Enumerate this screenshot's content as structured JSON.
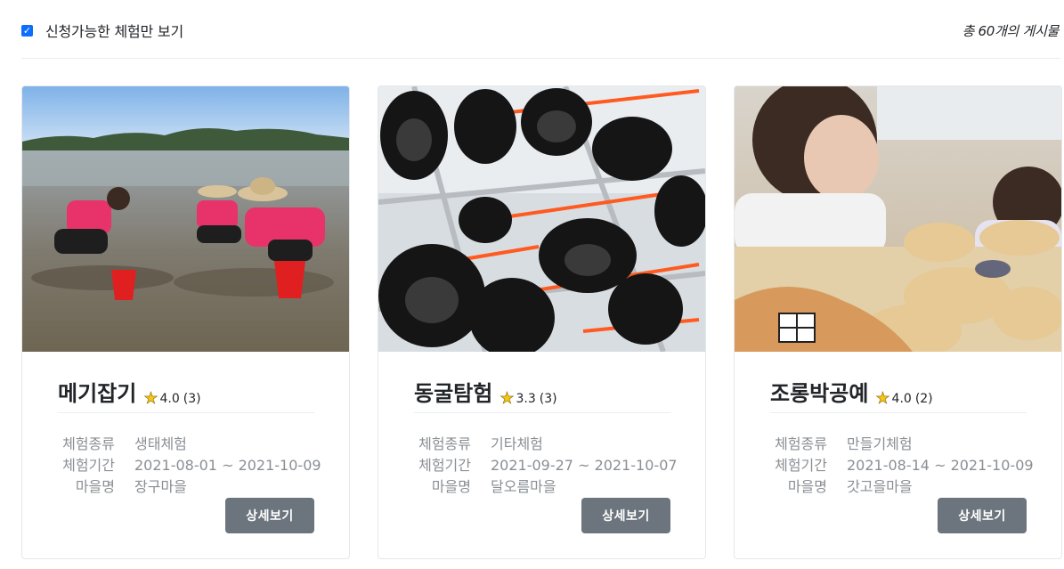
{
  "filter": {
    "checked": true,
    "label": "신청가능한 체험만 보기"
  },
  "total_count": "총 60개의 게시물",
  "cards": [
    {
      "title": "메기잡기",
      "rating": "4.0",
      "review_count": "(3)",
      "type_label": "체험종류",
      "type_value": "생태체험",
      "period_label": "체험기간",
      "period_value": "2021-08-01 ~ 2021-10-09",
      "village_label": "마을명",
      "village_value": "장구마을",
      "button_label": "상세보기"
    },
    {
      "title": "동굴탐험",
      "rating": "3.3",
      "review_count": "(3)",
      "type_label": "체험종류",
      "type_value": "기타체험",
      "period_label": "체험기간",
      "period_value": "2021-09-27 ~ 2021-10-07",
      "village_label": "마을명",
      "village_value": "달오름마을",
      "button_label": "상세보기"
    },
    {
      "title": "조롱박공예",
      "rating": "4.0",
      "review_count": "(2)",
      "type_label": "체험종류",
      "type_value": "만들기체험",
      "period_label": "체험기간",
      "period_value": "2021-08-14 ~ 2021-10-09",
      "village_label": "마을명",
      "village_value": "갓고을마을",
      "button_label": "상세보기"
    }
  ],
  "colors": {
    "checkbox": "#0d6efd",
    "button": "#6c757d",
    "star": "#f5c518"
  }
}
